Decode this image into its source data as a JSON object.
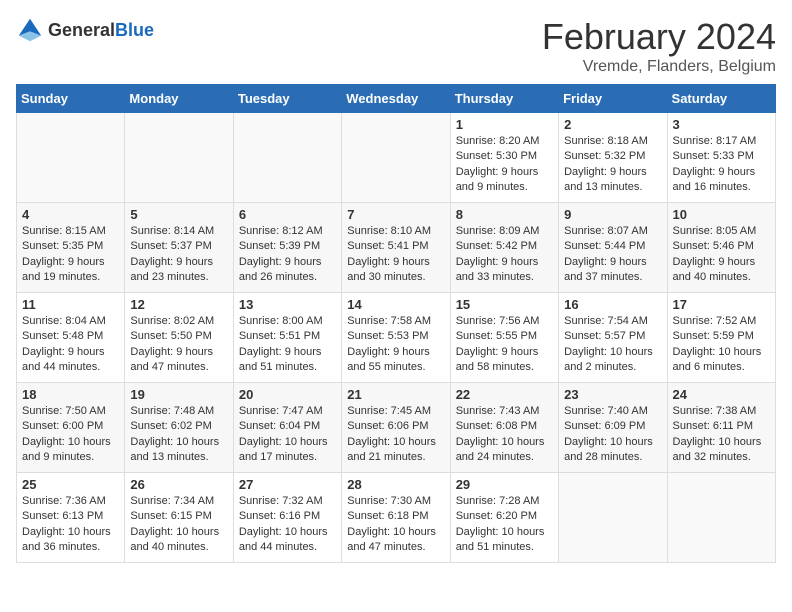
{
  "header": {
    "logo": {
      "general": "General",
      "blue": "Blue",
      "arrow_unicode": "▶"
    },
    "title": "February 2024",
    "subtitle": "Vremde, Flanders, Belgium"
  },
  "days_of_week": [
    "Sunday",
    "Monday",
    "Tuesday",
    "Wednesday",
    "Thursday",
    "Friday",
    "Saturday"
  ],
  "weeks": [
    [
      {
        "day": "",
        "sunrise": "",
        "sunset": "",
        "daylight": "",
        "empty": true
      },
      {
        "day": "",
        "sunrise": "",
        "sunset": "",
        "daylight": "",
        "empty": true
      },
      {
        "day": "",
        "sunrise": "",
        "sunset": "",
        "daylight": "",
        "empty": true
      },
      {
        "day": "",
        "sunrise": "",
        "sunset": "",
        "daylight": "",
        "empty": true
      },
      {
        "day": "1",
        "sunrise": "Sunrise: 8:20 AM",
        "sunset": "Sunset: 5:30 PM",
        "daylight": "Daylight: 9 hours and 9 minutes."
      },
      {
        "day": "2",
        "sunrise": "Sunrise: 8:18 AM",
        "sunset": "Sunset: 5:32 PM",
        "daylight": "Daylight: 9 hours and 13 minutes."
      },
      {
        "day": "3",
        "sunrise": "Sunrise: 8:17 AM",
        "sunset": "Sunset: 5:33 PM",
        "daylight": "Daylight: 9 hours and 16 minutes."
      }
    ],
    [
      {
        "day": "4",
        "sunrise": "Sunrise: 8:15 AM",
        "sunset": "Sunset: 5:35 PM",
        "daylight": "Daylight: 9 hours and 19 minutes."
      },
      {
        "day": "5",
        "sunrise": "Sunrise: 8:14 AM",
        "sunset": "Sunset: 5:37 PM",
        "daylight": "Daylight: 9 hours and 23 minutes."
      },
      {
        "day": "6",
        "sunrise": "Sunrise: 8:12 AM",
        "sunset": "Sunset: 5:39 PM",
        "daylight": "Daylight: 9 hours and 26 minutes."
      },
      {
        "day": "7",
        "sunrise": "Sunrise: 8:10 AM",
        "sunset": "Sunset: 5:41 PM",
        "daylight": "Daylight: 9 hours and 30 minutes."
      },
      {
        "day": "8",
        "sunrise": "Sunrise: 8:09 AM",
        "sunset": "Sunset: 5:42 PM",
        "daylight": "Daylight: 9 hours and 33 minutes."
      },
      {
        "day": "9",
        "sunrise": "Sunrise: 8:07 AM",
        "sunset": "Sunset: 5:44 PM",
        "daylight": "Daylight: 9 hours and 37 minutes."
      },
      {
        "day": "10",
        "sunrise": "Sunrise: 8:05 AM",
        "sunset": "Sunset: 5:46 PM",
        "daylight": "Daylight: 9 hours and 40 minutes."
      }
    ],
    [
      {
        "day": "11",
        "sunrise": "Sunrise: 8:04 AM",
        "sunset": "Sunset: 5:48 PM",
        "daylight": "Daylight: 9 hours and 44 minutes."
      },
      {
        "day": "12",
        "sunrise": "Sunrise: 8:02 AM",
        "sunset": "Sunset: 5:50 PM",
        "daylight": "Daylight: 9 hours and 47 minutes."
      },
      {
        "day": "13",
        "sunrise": "Sunrise: 8:00 AM",
        "sunset": "Sunset: 5:51 PM",
        "daylight": "Daylight: 9 hours and 51 minutes."
      },
      {
        "day": "14",
        "sunrise": "Sunrise: 7:58 AM",
        "sunset": "Sunset: 5:53 PM",
        "daylight": "Daylight: 9 hours and 55 minutes."
      },
      {
        "day": "15",
        "sunrise": "Sunrise: 7:56 AM",
        "sunset": "Sunset: 5:55 PM",
        "daylight": "Daylight: 9 hours and 58 minutes."
      },
      {
        "day": "16",
        "sunrise": "Sunrise: 7:54 AM",
        "sunset": "Sunset: 5:57 PM",
        "daylight": "Daylight: 10 hours and 2 minutes."
      },
      {
        "day": "17",
        "sunrise": "Sunrise: 7:52 AM",
        "sunset": "Sunset: 5:59 PM",
        "daylight": "Daylight: 10 hours and 6 minutes."
      }
    ],
    [
      {
        "day": "18",
        "sunrise": "Sunrise: 7:50 AM",
        "sunset": "Sunset: 6:00 PM",
        "daylight": "Daylight: 10 hours and 9 minutes."
      },
      {
        "day": "19",
        "sunrise": "Sunrise: 7:48 AM",
        "sunset": "Sunset: 6:02 PM",
        "daylight": "Daylight: 10 hours and 13 minutes."
      },
      {
        "day": "20",
        "sunrise": "Sunrise: 7:47 AM",
        "sunset": "Sunset: 6:04 PM",
        "daylight": "Daylight: 10 hours and 17 minutes."
      },
      {
        "day": "21",
        "sunrise": "Sunrise: 7:45 AM",
        "sunset": "Sunset: 6:06 PM",
        "daylight": "Daylight: 10 hours and 21 minutes."
      },
      {
        "day": "22",
        "sunrise": "Sunrise: 7:43 AM",
        "sunset": "Sunset: 6:08 PM",
        "daylight": "Daylight: 10 hours and 24 minutes."
      },
      {
        "day": "23",
        "sunrise": "Sunrise: 7:40 AM",
        "sunset": "Sunset: 6:09 PM",
        "daylight": "Daylight: 10 hours and 28 minutes."
      },
      {
        "day": "24",
        "sunrise": "Sunrise: 7:38 AM",
        "sunset": "Sunset: 6:11 PM",
        "daylight": "Daylight: 10 hours and 32 minutes."
      }
    ],
    [
      {
        "day": "25",
        "sunrise": "Sunrise: 7:36 AM",
        "sunset": "Sunset: 6:13 PM",
        "daylight": "Daylight: 10 hours and 36 minutes."
      },
      {
        "day": "26",
        "sunrise": "Sunrise: 7:34 AM",
        "sunset": "Sunset: 6:15 PM",
        "daylight": "Daylight: 10 hours and 40 minutes."
      },
      {
        "day": "27",
        "sunrise": "Sunrise: 7:32 AM",
        "sunset": "Sunset: 6:16 PM",
        "daylight": "Daylight: 10 hours and 44 minutes."
      },
      {
        "day": "28",
        "sunrise": "Sunrise: 7:30 AM",
        "sunset": "Sunset: 6:18 PM",
        "daylight": "Daylight: 10 hours and 47 minutes."
      },
      {
        "day": "29",
        "sunrise": "Sunrise: 7:28 AM",
        "sunset": "Sunset: 6:20 PM",
        "daylight": "Daylight: 10 hours and 51 minutes."
      },
      {
        "day": "",
        "sunrise": "",
        "sunset": "",
        "daylight": "",
        "empty": true
      },
      {
        "day": "",
        "sunrise": "",
        "sunset": "",
        "daylight": "",
        "empty": true
      }
    ]
  ]
}
